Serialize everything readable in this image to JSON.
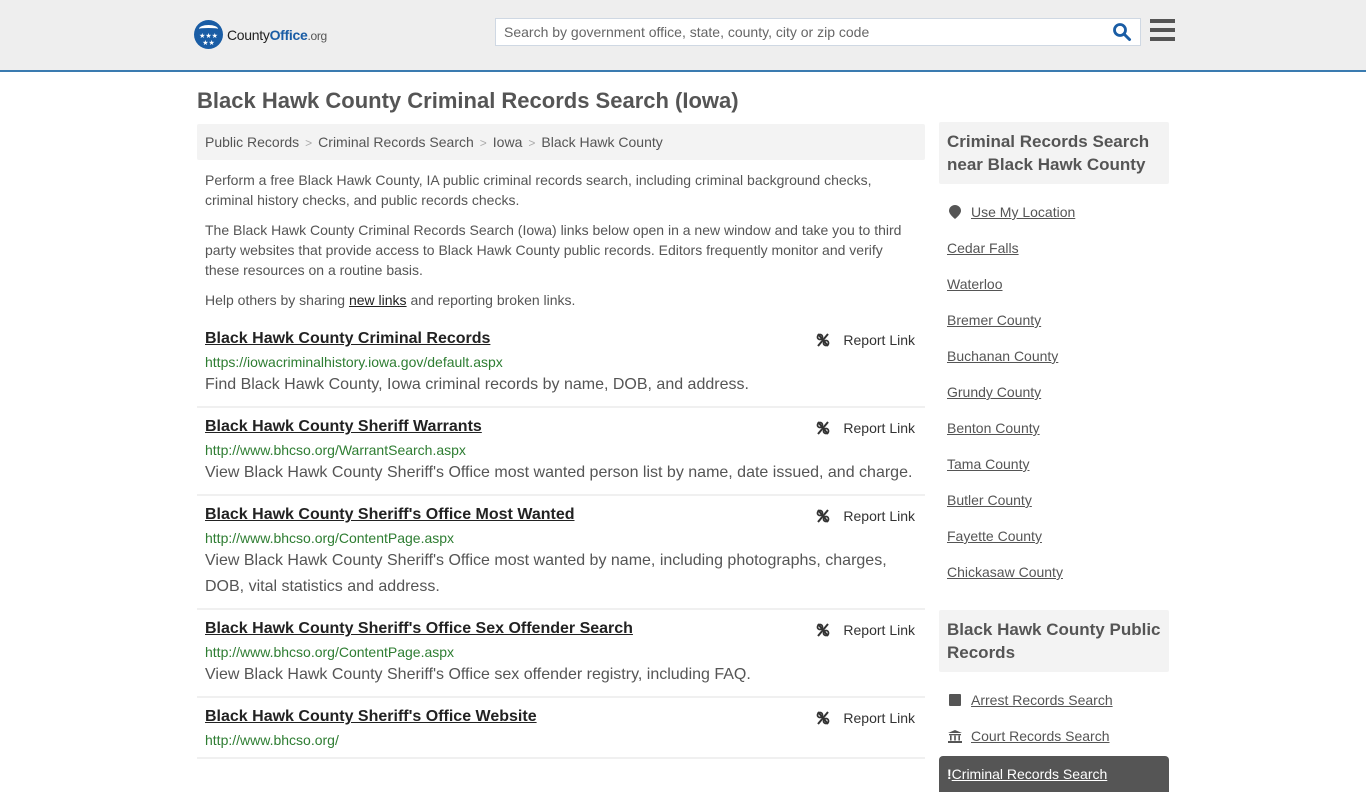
{
  "header": {
    "logo": {
      "county": "County",
      "office": "Office",
      "org": ".org"
    },
    "search": {
      "placeholder": "Search by government office, state, county, city or zip code",
      "value": ""
    },
    "search_icon": "search-icon",
    "menu_icon": "hamburger-menu-icon"
  },
  "page": {
    "title": "Black Hawk County Criminal Records Search (Iowa)"
  },
  "breadcrumb": [
    {
      "label": "Public Records"
    },
    {
      "label": "Criminal Records Search"
    },
    {
      "label": "Iowa"
    },
    {
      "label": "Black Hawk County"
    }
  ],
  "intro": {
    "p1": "Perform a free Black Hawk County, IA public criminal records search, including criminal background checks, criminal history checks, and public records checks.",
    "p2": "The Black Hawk County Criminal Records Search (Iowa) links below open in a new window and take you to third party websites that provide access to Black Hawk County public records. Editors frequently monitor and verify these resources on a routine basis.",
    "p3_before": "Help others by sharing ",
    "p3_link": "new links",
    "p3_after": " and reporting broken links."
  },
  "results": [
    {
      "title": "Black Hawk County Criminal Records",
      "url": "https://iowacriminalhistory.iowa.gov/default.aspx",
      "desc": "Find Black Hawk County, Iowa criminal records by name, DOB, and address.",
      "report": "Report Link"
    },
    {
      "title": "Black Hawk County Sheriff Warrants",
      "url": "http://www.bhcso.org/WarrantSearch.aspx",
      "desc": "View Black Hawk County Sheriff's Office most wanted person list by name, date issued, and charge.",
      "report": "Report Link"
    },
    {
      "title": "Black Hawk County Sheriff's Office Most Wanted",
      "url": "http://www.bhcso.org/ContentPage.aspx",
      "desc": "View Black Hawk County Sheriff's Office most wanted by name, including photographs, charges, DOB, vital statistics and address.",
      "report": "Report Link"
    },
    {
      "title": "Black Hawk County Sheriff's Office Sex Offender Search",
      "url": "http://www.bhcso.org/ContentPage.aspx",
      "desc": "View Black Hawk County Sheriff's Office sex offender registry, including FAQ.",
      "report": "Report Link"
    },
    {
      "title": "Black Hawk County Sheriff's Office Website",
      "url": "http://www.bhcso.org/",
      "desc": "",
      "report": "Report Link"
    }
  ],
  "sidebar": {
    "nearby": {
      "heading": "Criminal Records Search near Black Hawk County",
      "use_location": "Use My Location",
      "items": [
        "Cedar Falls",
        "Waterloo",
        "Bremer County",
        "Buchanan County",
        "Grundy County",
        "Benton County",
        "Tama County",
        "Butler County",
        "Fayette County",
        "Chickasaw County"
      ]
    },
    "public_records": {
      "heading": "Black Hawk County Public Records",
      "items": [
        {
          "label": "Arrest Records Search",
          "icon": "square-icon"
        },
        {
          "label": "Court Records Search",
          "icon": "courthouse-icon"
        },
        {
          "label": "Criminal Records Search",
          "icon": "exclamation-icon",
          "active": true
        }
      ]
    }
  },
  "colors": {
    "accent_blue": "#1a5da5",
    "header_border": "#3a7bb0",
    "url_green": "#2e7d32",
    "active_bg": "#555555"
  }
}
